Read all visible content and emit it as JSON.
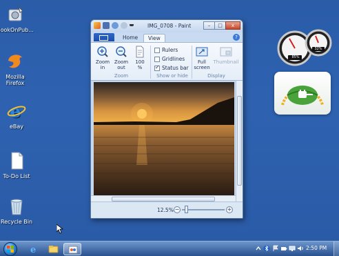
{
  "desktop": {
    "icons": [
      {
        "label": "BookOnPub...",
        "icon": "disk-utility-icon"
      },
      {
        "label": "Mozilla Firefox",
        "icon": "firefox-icon"
      },
      {
        "label": "eBay",
        "icon": "internet-explorer-icon"
      },
      {
        "label": "To-Do List",
        "icon": "text-document-icon"
      },
      {
        "label": "Recycle Bin",
        "icon": "recycle-bin-icon"
      }
    ]
  },
  "window": {
    "title": "IMG_0708 - Paint",
    "controls": {
      "minimize": "–",
      "maximize": "□",
      "close": "x"
    },
    "tabs": [
      {
        "label": "Home",
        "active": false
      },
      {
        "label": "View",
        "active": true
      }
    ],
    "help": "?",
    "ribbon": {
      "zoom_group": {
        "label": "Zoom",
        "buttons": [
          {
            "label": "Zoom\nin",
            "l1": "Zoom",
            "l2": "in"
          },
          {
            "label": "Zoom\nout",
            "l1": "Zoom",
            "l2": "out"
          },
          {
            "label": "100\n%",
            "l1": "100",
            "l2": "%"
          }
        ]
      },
      "show_group": {
        "label": "Show or hide",
        "checks": [
          {
            "label": "Rulers",
            "checked": false
          },
          {
            "label": "Gridlines",
            "checked": false
          },
          {
            "label": "Status bar",
            "checked": true
          }
        ]
      },
      "display_group": {
        "label": "Display",
        "buttons": [
          {
            "l1": "Full",
            "l2": "screen",
            "enabled": true
          },
          {
            "l1": "Thumbnail",
            "l2": "",
            "enabled": false
          }
        ]
      }
    },
    "status": {
      "zoom": "12.5%",
      "minus": "−",
      "plus": "+"
    }
  },
  "gadgets": {
    "meter": {
      "left_readout": "85%",
      "right_readout": "32%"
    }
  },
  "taskbar": {
    "clock": "2:50 PM",
    "pinned": [
      "internet-explorer-icon",
      "windows-explorer-icon",
      "paint-icon"
    ]
  },
  "colors": {
    "desktop": "#2a5ca8",
    "accent": "#1c4ea8"
  }
}
